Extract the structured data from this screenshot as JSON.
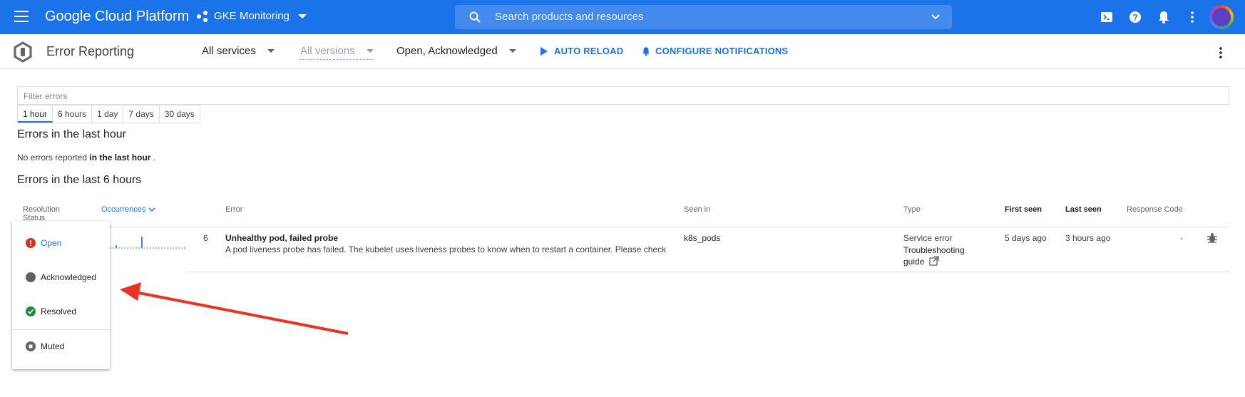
{
  "topbar": {
    "brand": "Google Cloud Platform",
    "project": "GKE Monitoring",
    "search_placeholder": "Search products and resources",
    "color": "#1a73e8"
  },
  "subbar": {
    "title": "Error Reporting",
    "services": "All services",
    "versions": "All versions",
    "status_filter": "Open, Acknowledged",
    "auto_reload": "AUTO RELOAD",
    "configure_notifications": "CONFIGURE NOTIFICATIONS"
  },
  "filter": {
    "placeholder": "Filter errors",
    "ranges": [
      "1 hour",
      "6 hours",
      "1 day",
      "7 days",
      "30 days"
    ],
    "active_range": "1 hour"
  },
  "section_hour": {
    "heading": "Errors in the last hour",
    "note_prefix": "No errors reported",
    "note_bold": "in the last hour",
    "note_suffix": "."
  },
  "section_6h": {
    "heading": "Errors in the last 6 hours",
    "columns": {
      "status": "Resolution Status",
      "occurrences": "Occurrences",
      "error": "Error",
      "seen_in": "Seen in",
      "type": "Type",
      "first_seen": "First seen",
      "last_seen": "Last seen",
      "response_code": "Response Code"
    },
    "rows": [
      {
        "count": "6",
        "title": "Unhealthy pod, failed probe",
        "message": "A pod liveness probe has failed. The kubelet uses liveness probes to know when to restart a container. Please check",
        "seen_in": "k8s_pods",
        "type": "Service error",
        "guide": "Troubleshooting guide",
        "first_seen": "5 days ago",
        "last_seen": "3 hours ago",
        "response_code": "-"
      }
    ]
  },
  "status_menu": {
    "items": [
      {
        "label": "Open",
        "icon": "error-icon",
        "color": "#d93025"
      },
      {
        "label": "Acknowledged",
        "icon": "circle-icon",
        "color": "#5f6368"
      },
      {
        "label": "Resolved",
        "icon": "check-circle-icon",
        "color": "#1e8e3e"
      },
      {
        "label": "Muted",
        "icon": "muted-icon",
        "color": "#5f6368"
      }
    ]
  },
  "annotation": {
    "arrow_color": "#ea3323"
  }
}
